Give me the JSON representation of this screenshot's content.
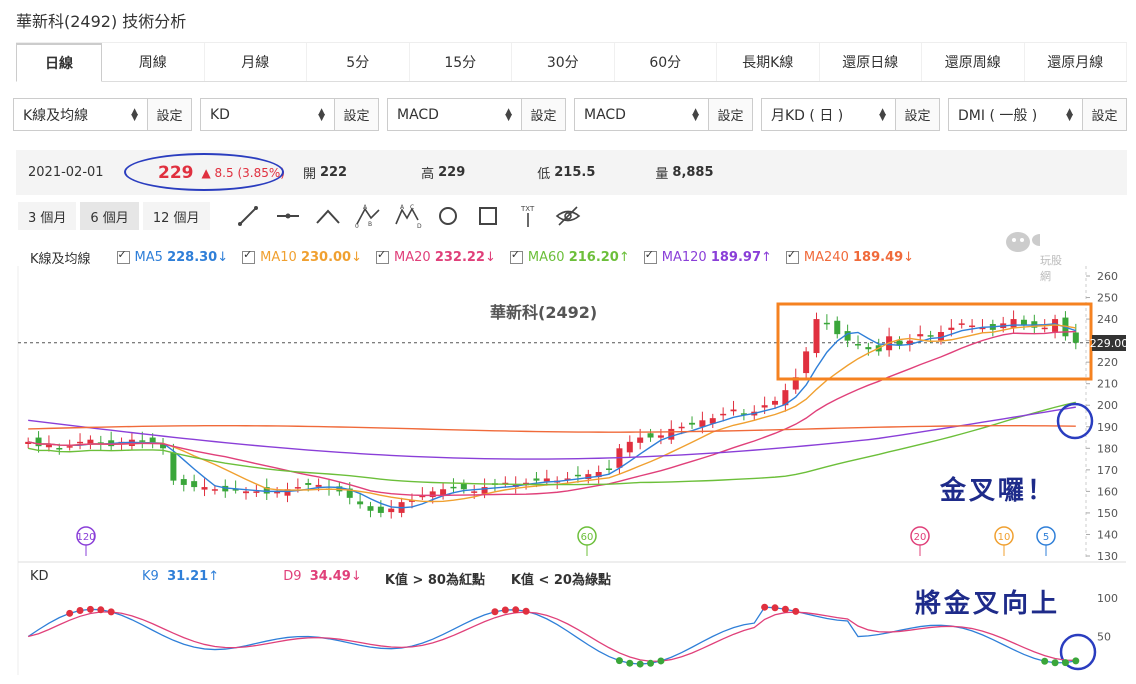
{
  "page_title": "華新科(2492) 技術分析",
  "tabs": [
    "日線",
    "周線",
    "月線",
    "5分",
    "15分",
    "30分",
    "60分",
    "長期K線",
    "還原日線",
    "還原周線",
    "還原月線"
  ],
  "active_tab": "日線",
  "selects": [
    {
      "value": "K線及均線",
      "btn": "設定"
    },
    {
      "value": "KD",
      "btn": "設定"
    },
    {
      "value": "MACD",
      "btn": "設定"
    },
    {
      "value": "MACD",
      "btn": "設定"
    },
    {
      "value": "月KD ( 日 )",
      "btn": "設定"
    },
    {
      "value": "DMI ( 一般 )",
      "btn": "設定"
    }
  ],
  "quote": {
    "date": "2021-02-01",
    "price": "229",
    "change": "▲ 8.5 (3.85%)",
    "open_label": "開",
    "open": "222",
    "high_label": "高",
    "high": "229",
    "low_label": "低",
    "low": "215.5",
    "volume_label": "量",
    "volume": "8,885"
  },
  "periods": [
    "3 個月",
    "6 個月",
    "12 個月"
  ],
  "active_period": "6 個月",
  "ma_legend": {
    "title": "K線及均線",
    "items": [
      {
        "name": "MA5",
        "value": "228.30",
        "arrow": "↓",
        "color": "#2f7fd8"
      },
      {
        "name": "MA10",
        "value": "230.00",
        "arrow": "↓",
        "color": "#f0a030"
      },
      {
        "name": "MA20",
        "value": "232.22",
        "arrow": "↓",
        "color": "#e0407a"
      },
      {
        "name": "MA60",
        "value": "216.20",
        "arrow": "↑",
        "color": "#6cbf3a"
      },
      {
        "name": "MA120",
        "value": "189.97",
        "arrow": "↑",
        "color": "#8a3fd8"
      },
      {
        "name": "MA240",
        "value": "189.49",
        "arrow": "↓",
        "color": "#f06a3a"
      }
    ]
  },
  "chart_title": "華新科(2492)",
  "price_tag": "229.00",
  "y_ticks": [
    "260",
    "250",
    "240",
    "230",
    "220",
    "210",
    "200",
    "190",
    "180",
    "170",
    "160",
    "150",
    "140",
    "130"
  ],
  "kd_ticks": [
    "100",
    "50"
  ],
  "ma_markers": [
    "120",
    "60",
    "20",
    "10",
    "5"
  ],
  "kd_legend": {
    "title": "KD",
    "k_label": "K9",
    "k_value": "31.21",
    "k_arrow": "↑",
    "d_label": "D9",
    "d_value": "34.49",
    "d_arrow": "↓",
    "note1": "K值 > 80為紅點",
    "note2": "K值 < 20為綠點"
  },
  "annotations": {
    "golden_cross": "金叉囉！",
    "about_to_cross": "將金叉向上"
  },
  "watermark": "玩股網",
  "colors": {
    "up": "#e0303f",
    "down": "#3aa63a",
    "annotation": "#1e2b8a",
    "box": "#f58220"
  },
  "chart_data": {
    "type": "line",
    "ylim": [
      130,
      260
    ],
    "close_approx": [
      183,
      181,
      182,
      180,
      181,
      183,
      184,
      182,
      181,
      183,
      184,
      183,
      182,
      180,
      165,
      163,
      162,
      162,
      161,
      160,
      161,
      160,
      160,
      159,
      160,
      161,
      162,
      163,
      163,
      161,
      160,
      157,
      154,
      151,
      150,
      152,
      155,
      156,
      158,
      160,
      161,
      162,
      161,
      160,
      162,
      163,
      164,
      163,
      164,
      165,
      166,
      165,
      166,
      167,
      168,
      169,
      170,
      180,
      183,
      185,
      185,
      186,
      189,
      190,
      191,
      193,
      194,
      196,
      198,
      196,
      197,
      200,
      202,
      207,
      213,
      225,
      240,
      238,
      233,
      230,
      228,
      226,
      225,
      232,
      228,
      230,
      233,
      232,
      234,
      236,
      238,
      237,
      236,
      235,
      238,
      240,
      237,
      236,
      236,
      240,
      232,
      229
    ]
  }
}
